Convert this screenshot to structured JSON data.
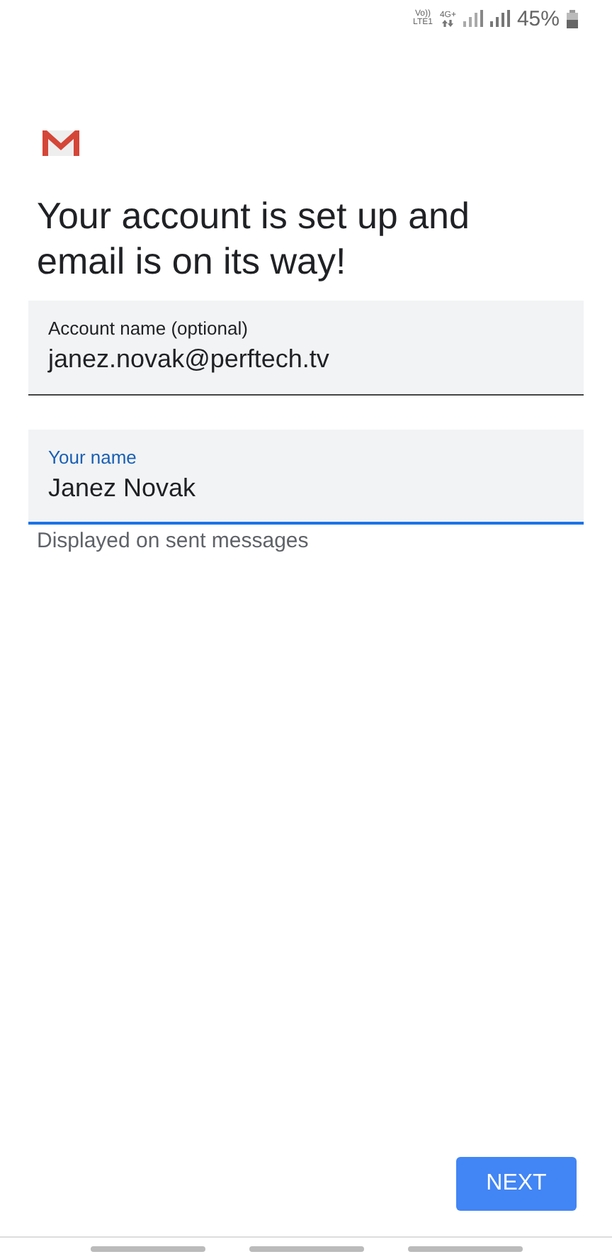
{
  "status_bar": {
    "network_labels": [
      "Vo))",
      "LTE1",
      "4G+"
    ],
    "battery": "45%"
  },
  "title": "Your account is set up and email is on its way!",
  "fields": [
    {
      "label": "Account name (optional)",
      "value": "janez.novak@perftech.tv",
      "focused": false
    },
    {
      "label": "Your name",
      "value": "Janez Novak",
      "focused": true,
      "helper": "Displayed on sent messages"
    }
  ],
  "next_button": "NEXT"
}
